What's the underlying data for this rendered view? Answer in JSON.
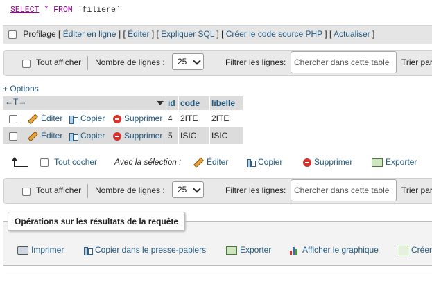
{
  "sql": {
    "kw1": "SELECT",
    "star": "*",
    "kw2": "FROM",
    "table": "`filiere`"
  },
  "profiling": {
    "label": "Profilage",
    "links": [
      "Éditer en ligne",
      "Éditer",
      "Expliquer SQL",
      "Créer le code source PHP",
      "Actualiser"
    ]
  },
  "nav_top": {
    "show_all": "Tout afficher",
    "rows_label": "Nombre de lignes :",
    "rows_value": "25",
    "filter_label": "Filtrer les lignes:",
    "filter_placeholder": "Chercher dans cette table",
    "sort_label": "Trier par"
  },
  "options_link": "+ Options",
  "table": {
    "columns": [
      "id",
      "code",
      "libelle"
    ],
    "actions": {
      "edit": "Éditer",
      "copy": "Copier",
      "delete": "Supprimer"
    },
    "rows": [
      {
        "id": "4",
        "code": "2ITE",
        "libelle": "2ITE"
      },
      {
        "id": "5",
        "code": "ISIC",
        "libelle": "ISIC"
      }
    ]
  },
  "selection": {
    "check_all": "Tout cocher",
    "with_selection": "Avec la sélection :",
    "edit": "Éditer",
    "copy": "Copier",
    "delete": "Supprimer",
    "export": "Exporter"
  },
  "nav_bottom": {
    "show_all": "Tout afficher",
    "rows_label": "Nombre de lignes :",
    "rows_value": "25",
    "filter_label": "Filtrer les lignes:",
    "filter_placeholder": "Chercher dans cette table",
    "sort_label": "Trier par"
  },
  "operations": {
    "legend": "Opérations sur les résultats de la requête",
    "print": "Imprimer",
    "copy_clipboard": "Copier dans le presse-papiers",
    "export": "Exporter",
    "chart": "Afficher le graphique",
    "create": "Créer"
  }
}
